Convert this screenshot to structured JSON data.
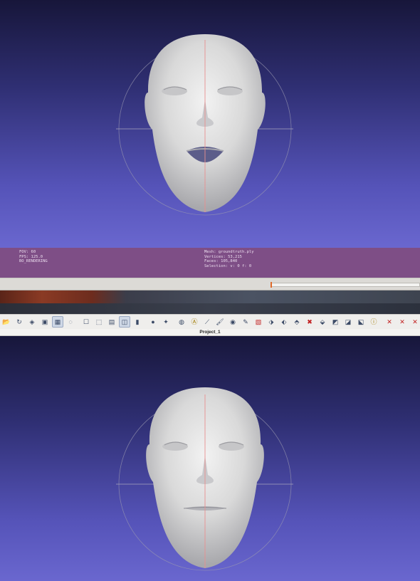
{
  "colors": {
    "viewport_top": "#17163a",
    "viewport_bottom": "#6a67cf",
    "info_bar": "#7e4e86",
    "trackball": "#9a98b0",
    "axis_line": "#e88f8f"
  },
  "info": {
    "left_lines": [
      "FOV: 60",
      "FPS:  125.0",
      "BO_RENDERING"
    ],
    "right_lines": [
      "Mesh: groundtruth.ply",
      "Vertices: 53,215",
      "Faces: 105,840",
      "Selection: v: 0 f: 0"
    ]
  },
  "toolbar": {
    "icons": [
      {
        "name": "open-icon",
        "glyph": "📂",
        "active": false
      },
      {
        "name": "reload-icon",
        "glyph": "↻",
        "active": false
      },
      {
        "name": "save-icon",
        "glyph": "◈",
        "active": false
      },
      {
        "name": "snapshot-icon",
        "glyph": "▣",
        "active": false
      },
      {
        "name": "render-mode-icon",
        "glyph": "▦",
        "active": true
      },
      {
        "name": "points-icon",
        "glyph": "◌",
        "active": false
      },
      {
        "name": "sep",
        "glyph": "",
        "active": false
      },
      {
        "name": "box-icon",
        "glyph": "☐",
        "active": false
      },
      {
        "name": "wireframe-icon",
        "glyph": "⬚",
        "active": false
      },
      {
        "name": "hidden-lines-icon",
        "glyph": "▤",
        "active": false
      },
      {
        "name": "flat-shading-icon",
        "glyph": "◫",
        "active": true
      },
      {
        "name": "smooth-shading-icon",
        "glyph": "▮",
        "active": false
      },
      {
        "name": "sep",
        "glyph": "",
        "active": false
      },
      {
        "name": "lighting-icon",
        "glyph": "●",
        "active": false
      },
      {
        "name": "double-side-icon",
        "glyph": "✦",
        "active": false
      },
      {
        "name": "sep",
        "glyph": "",
        "active": false
      },
      {
        "name": "color-icon",
        "glyph": "◍",
        "active": false
      },
      {
        "name": "annotation-icon",
        "glyph": "Ⓐ",
        "active": false
      },
      {
        "name": "measure-icon",
        "glyph": "⟋",
        "active": false
      },
      {
        "name": "paint-icon",
        "glyph": "🖌",
        "active": false
      },
      {
        "name": "pick-icon",
        "glyph": "◉",
        "active": false
      },
      {
        "name": "brush-icon",
        "glyph": "✎",
        "active": false
      },
      {
        "name": "layer-red-icon",
        "glyph": "▧",
        "active": false
      },
      {
        "name": "select-faces-icon",
        "glyph": "⬗",
        "active": false
      },
      {
        "name": "select-vertices-icon",
        "glyph": "⬖",
        "active": false
      },
      {
        "name": "select-connected-icon",
        "glyph": "⬘",
        "active": false
      },
      {
        "name": "delete-selection-icon",
        "glyph": "✖",
        "active": false
      },
      {
        "name": "select-region-icon",
        "glyph": "⬙",
        "active": false
      },
      {
        "name": "select-edges-icon",
        "glyph": "◩",
        "active": false
      },
      {
        "name": "select-components-icon",
        "glyph": "◪",
        "active": false
      },
      {
        "name": "select-bordered-icon",
        "glyph": "⬕",
        "active": false
      },
      {
        "name": "info-icon",
        "glyph": "ⓘ",
        "active": false
      },
      {
        "name": "sep",
        "glyph": "",
        "active": false
      },
      {
        "name": "delete-vertices-icon",
        "glyph": "✕",
        "active": false
      },
      {
        "name": "delete-faces-icon",
        "glyph": "✕",
        "active": false
      },
      {
        "name": "delete-both-icon",
        "glyph": "✕",
        "active": false
      }
    ]
  },
  "window": {
    "title": "Project_1"
  }
}
